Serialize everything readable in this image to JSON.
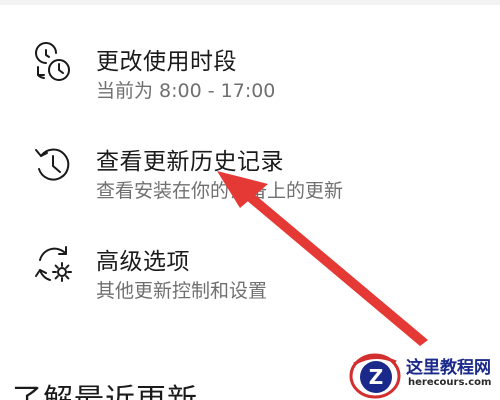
{
  "options": [
    {
      "title": "更改使用时段",
      "subtitle": "当前为 8:00 - 17:00",
      "icon": "clock-schedule-icon"
    },
    {
      "title": "查看更新历史记录",
      "subtitle": "查看安装在你的设备上的更新",
      "icon": "history-icon"
    },
    {
      "title": "高级选项",
      "subtitle": "其他更新控制和设置",
      "icon": "sync-settings-icon"
    }
  ],
  "section_heading": "了解最近更新",
  "annotation": {
    "arrow_color": "#e53935",
    "points_to": "查看更新历史记录"
  },
  "watermark": {
    "name": "这里教程网",
    "url": "herecours.com",
    "logo_letter": "Z",
    "colors": {
      "red": "#d32f2f",
      "blue": "#1b2a8a"
    }
  },
  "colors": {
    "title_text": "#1a1a1a",
    "subtitle_text": "#707070",
    "background": "#ffffff"
  }
}
